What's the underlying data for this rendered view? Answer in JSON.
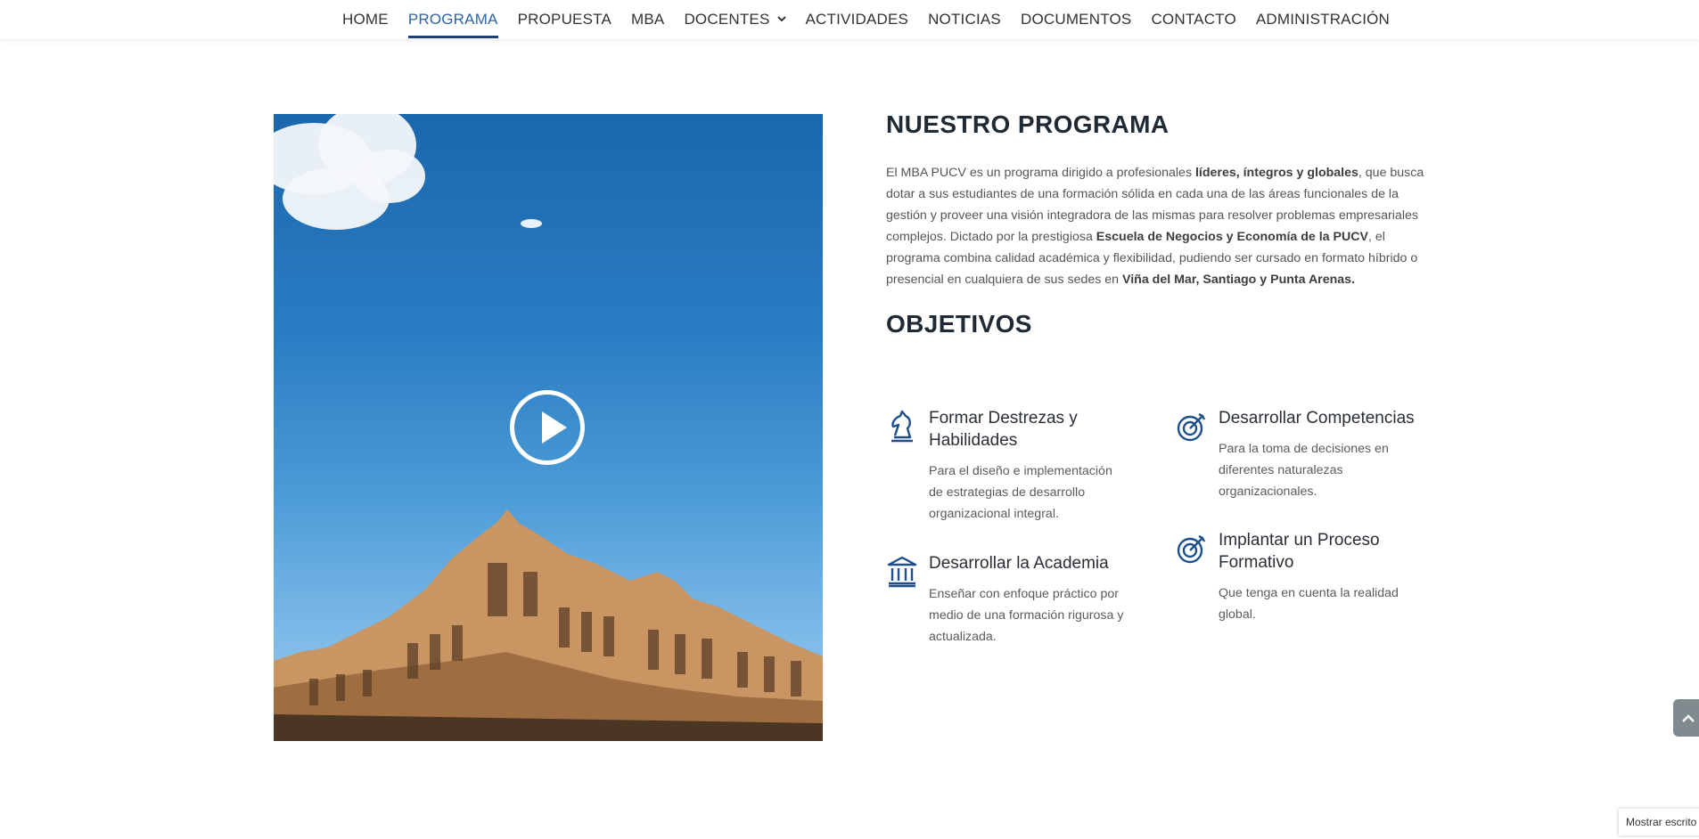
{
  "nav": {
    "items": [
      {
        "label": "HOME"
      },
      {
        "label": "PROGRAMA",
        "active": true
      },
      {
        "label": "PROPUESTA"
      },
      {
        "label": "MBA"
      },
      {
        "label": "DOCENTES",
        "dropdown": true
      },
      {
        "label": "ACTIVIDADES"
      },
      {
        "label": "NOTICIAS"
      },
      {
        "label": "DOCUMENTOS"
      },
      {
        "label": "CONTACTO"
      },
      {
        "label": "ADMINISTRACIÓN"
      }
    ],
    "active_color": "#2d64a6"
  },
  "program": {
    "heading": "NUESTRO PROGRAMA",
    "p1": "El MBA PUCV es un programa dirigido a profesionales ",
    "b1": "líderes, íntegros y globales",
    "p2": ", que busca dotar a sus estudiantes de una formación sólida en cada una de las áreas funcionales de la gestión y proveer una visión integradora de las mismas para resolver problemas empresariales complejos. Dictado por la prestigiosa ",
    "b2": "Escuela de Negocios y Economía de la PUCV",
    "p3": ", el programa combina calidad académica y flexibilidad, pudiendo ser cursado en formato híbrido o presencial en cualquiera de sus sedes en ",
    "b3": "Viña del Mar, Santiago y Punta Arenas."
  },
  "objectives": {
    "heading": "OBJETIVOS",
    "items": [
      {
        "title": "Formar Destrezas y Habilidades",
        "desc": "Para el diseño e implementación de estrategias de desarrollo organizacional integral.",
        "icon": "chess-knight-icon"
      },
      {
        "title": "Desarrollar Competencias",
        "desc": "Para la toma de decisiones en diferentes naturalezas organizacionales.",
        "icon": "target-icon"
      },
      {
        "title": "Desarrollar la Academia",
        "desc": "Enseñar con enfoque práctico por medio de una formación rigurosa y actualizada.",
        "icon": "institution-icon"
      },
      {
        "title": "Implantar un Proceso Formativo",
        "desc": "Que tenga en cuenta la realidad global.",
        "icon": "target-icon"
      }
    ]
  },
  "widget": {
    "label": "Mostrar escrito"
  },
  "icons": {
    "scroll_top": "chevron-up-icon",
    "play": "play-icon"
  }
}
